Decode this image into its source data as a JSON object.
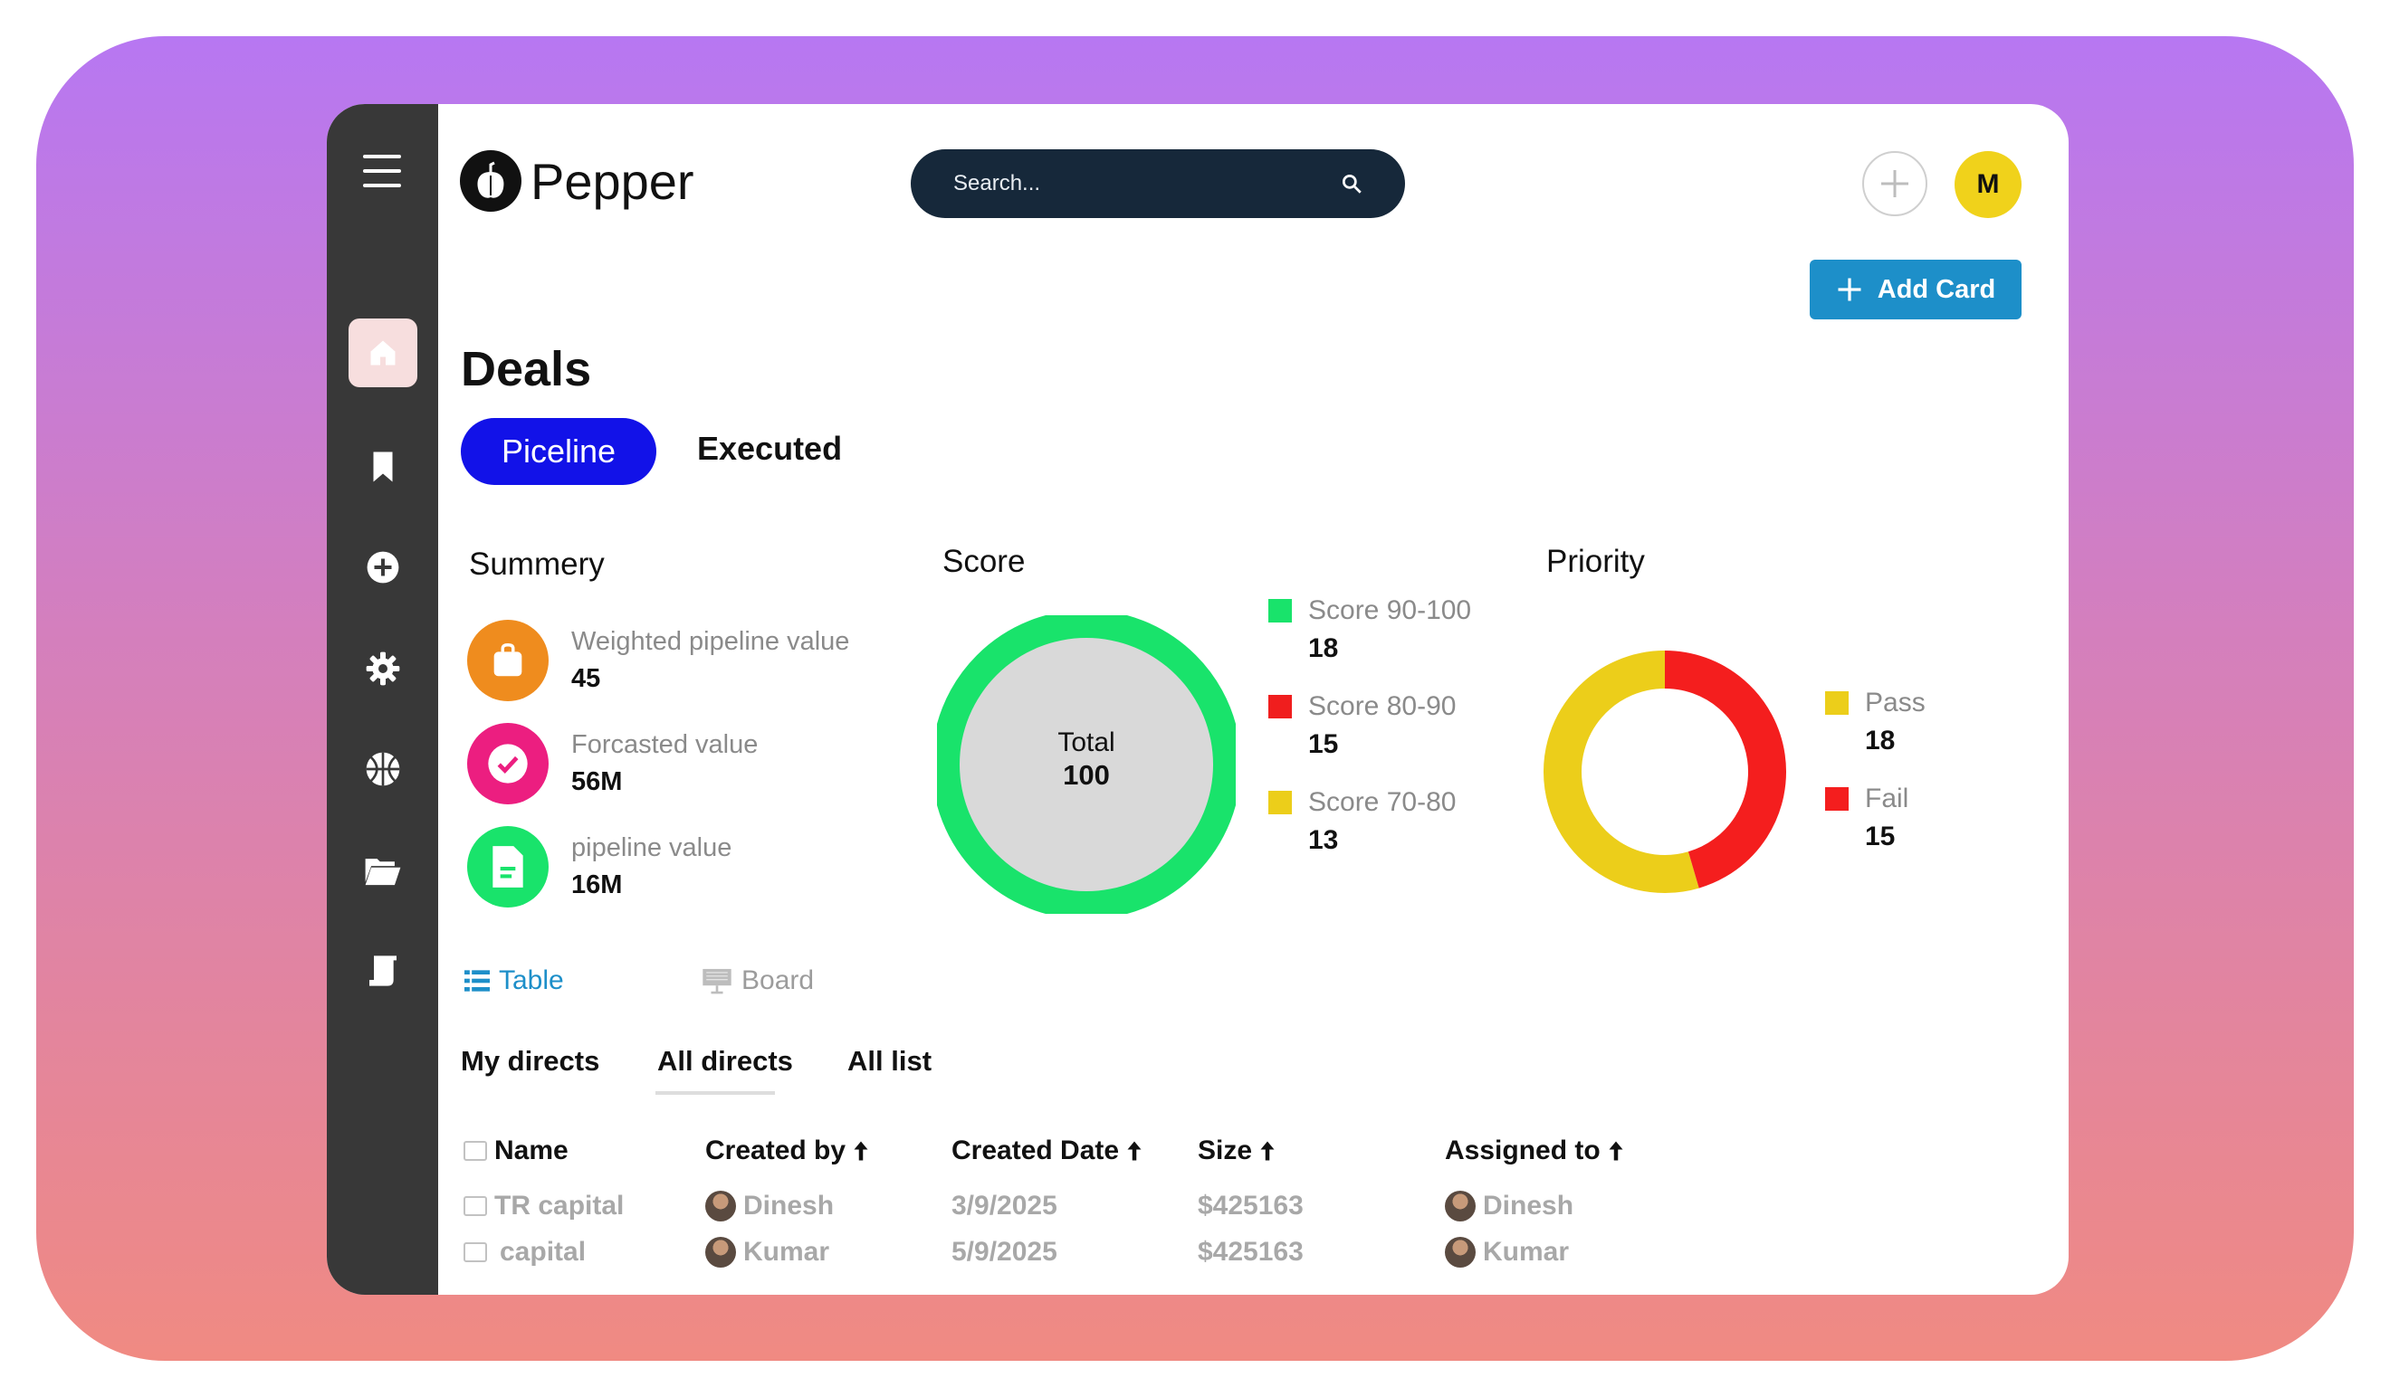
{
  "app": {
    "name": "Pepper"
  },
  "search": {
    "placeholder": "Search..."
  },
  "header": {
    "avatar_initial": "M",
    "add_card_label": "Add Card"
  },
  "page": {
    "title": "Deals"
  },
  "tabs": [
    {
      "label": "Piceline",
      "active": true
    },
    {
      "label": "Executed",
      "active": false
    }
  ],
  "sidebar": {
    "icons": [
      "menu-icon",
      "home-icon",
      "bookmark-icon",
      "add-circle-icon",
      "gear-icon",
      "basketball-icon",
      "folder-open-icon",
      "scroll-icon"
    ]
  },
  "summary": {
    "title": "Summery",
    "items": [
      {
        "label": "Weighted pipeline value",
        "value": "45",
        "icon": "bag-icon",
        "color": "#ef8c1e"
      },
      {
        "label": "Forcasted value",
        "value": "56M",
        "icon": "check-icon",
        "color": "#ec1e80"
      },
      {
        "label": "pipeline value",
        "value": "16M",
        "icon": "document-icon",
        "color": "#19e36b"
      }
    ]
  },
  "score": {
    "title": "Score",
    "center_label": "Total",
    "center_value": "100",
    "legend": [
      {
        "label": "Score 90-100",
        "value": "18",
        "color": "#19e36b"
      },
      {
        "label": "Score 80-90",
        "value": "15",
        "color": "#f01e1e"
      },
      {
        "label": "Score 70-80",
        "value": "13",
        "color": "#ecce1a"
      }
    ]
  },
  "priority": {
    "title": "Priority",
    "legend": [
      {
        "label": "Pass",
        "value": "18",
        "color": "#ecce1a"
      },
      {
        "label": "Fail",
        "value": "15",
        "color": "#f41e1e"
      }
    ]
  },
  "view_toggle": {
    "table": "Table",
    "board": "Board"
  },
  "subtabs": [
    "My directs",
    "All directs",
    "All list"
  ],
  "table": {
    "columns": [
      "Name",
      "Created by",
      "Created Date",
      "Size",
      "Assigned to"
    ],
    "rows": [
      {
        "name": "TR capital",
        "created_by": "Dinesh",
        "created_date": "3/9/2025",
        "size": "$425163",
        "assigned_to": "Dinesh"
      },
      {
        "name": "capital",
        "created_by": "Kumar",
        "created_date": "5/9/2025",
        "size": "$425163",
        "assigned_to": "Kumar"
      }
    ]
  },
  "chart_data": [
    {
      "type": "pie",
      "title": "Score",
      "categories": [
        "Score 90-100"
      ],
      "values": [
        100
      ],
      "colors": [
        "#19e36b"
      ]
    },
    {
      "type": "pie",
      "title": "Priority",
      "categories": [
        "Pass",
        "Fail"
      ],
      "values": [
        18,
        15
      ],
      "colors": [
        "#ecce1a",
        "#f41e1e"
      ]
    }
  ]
}
